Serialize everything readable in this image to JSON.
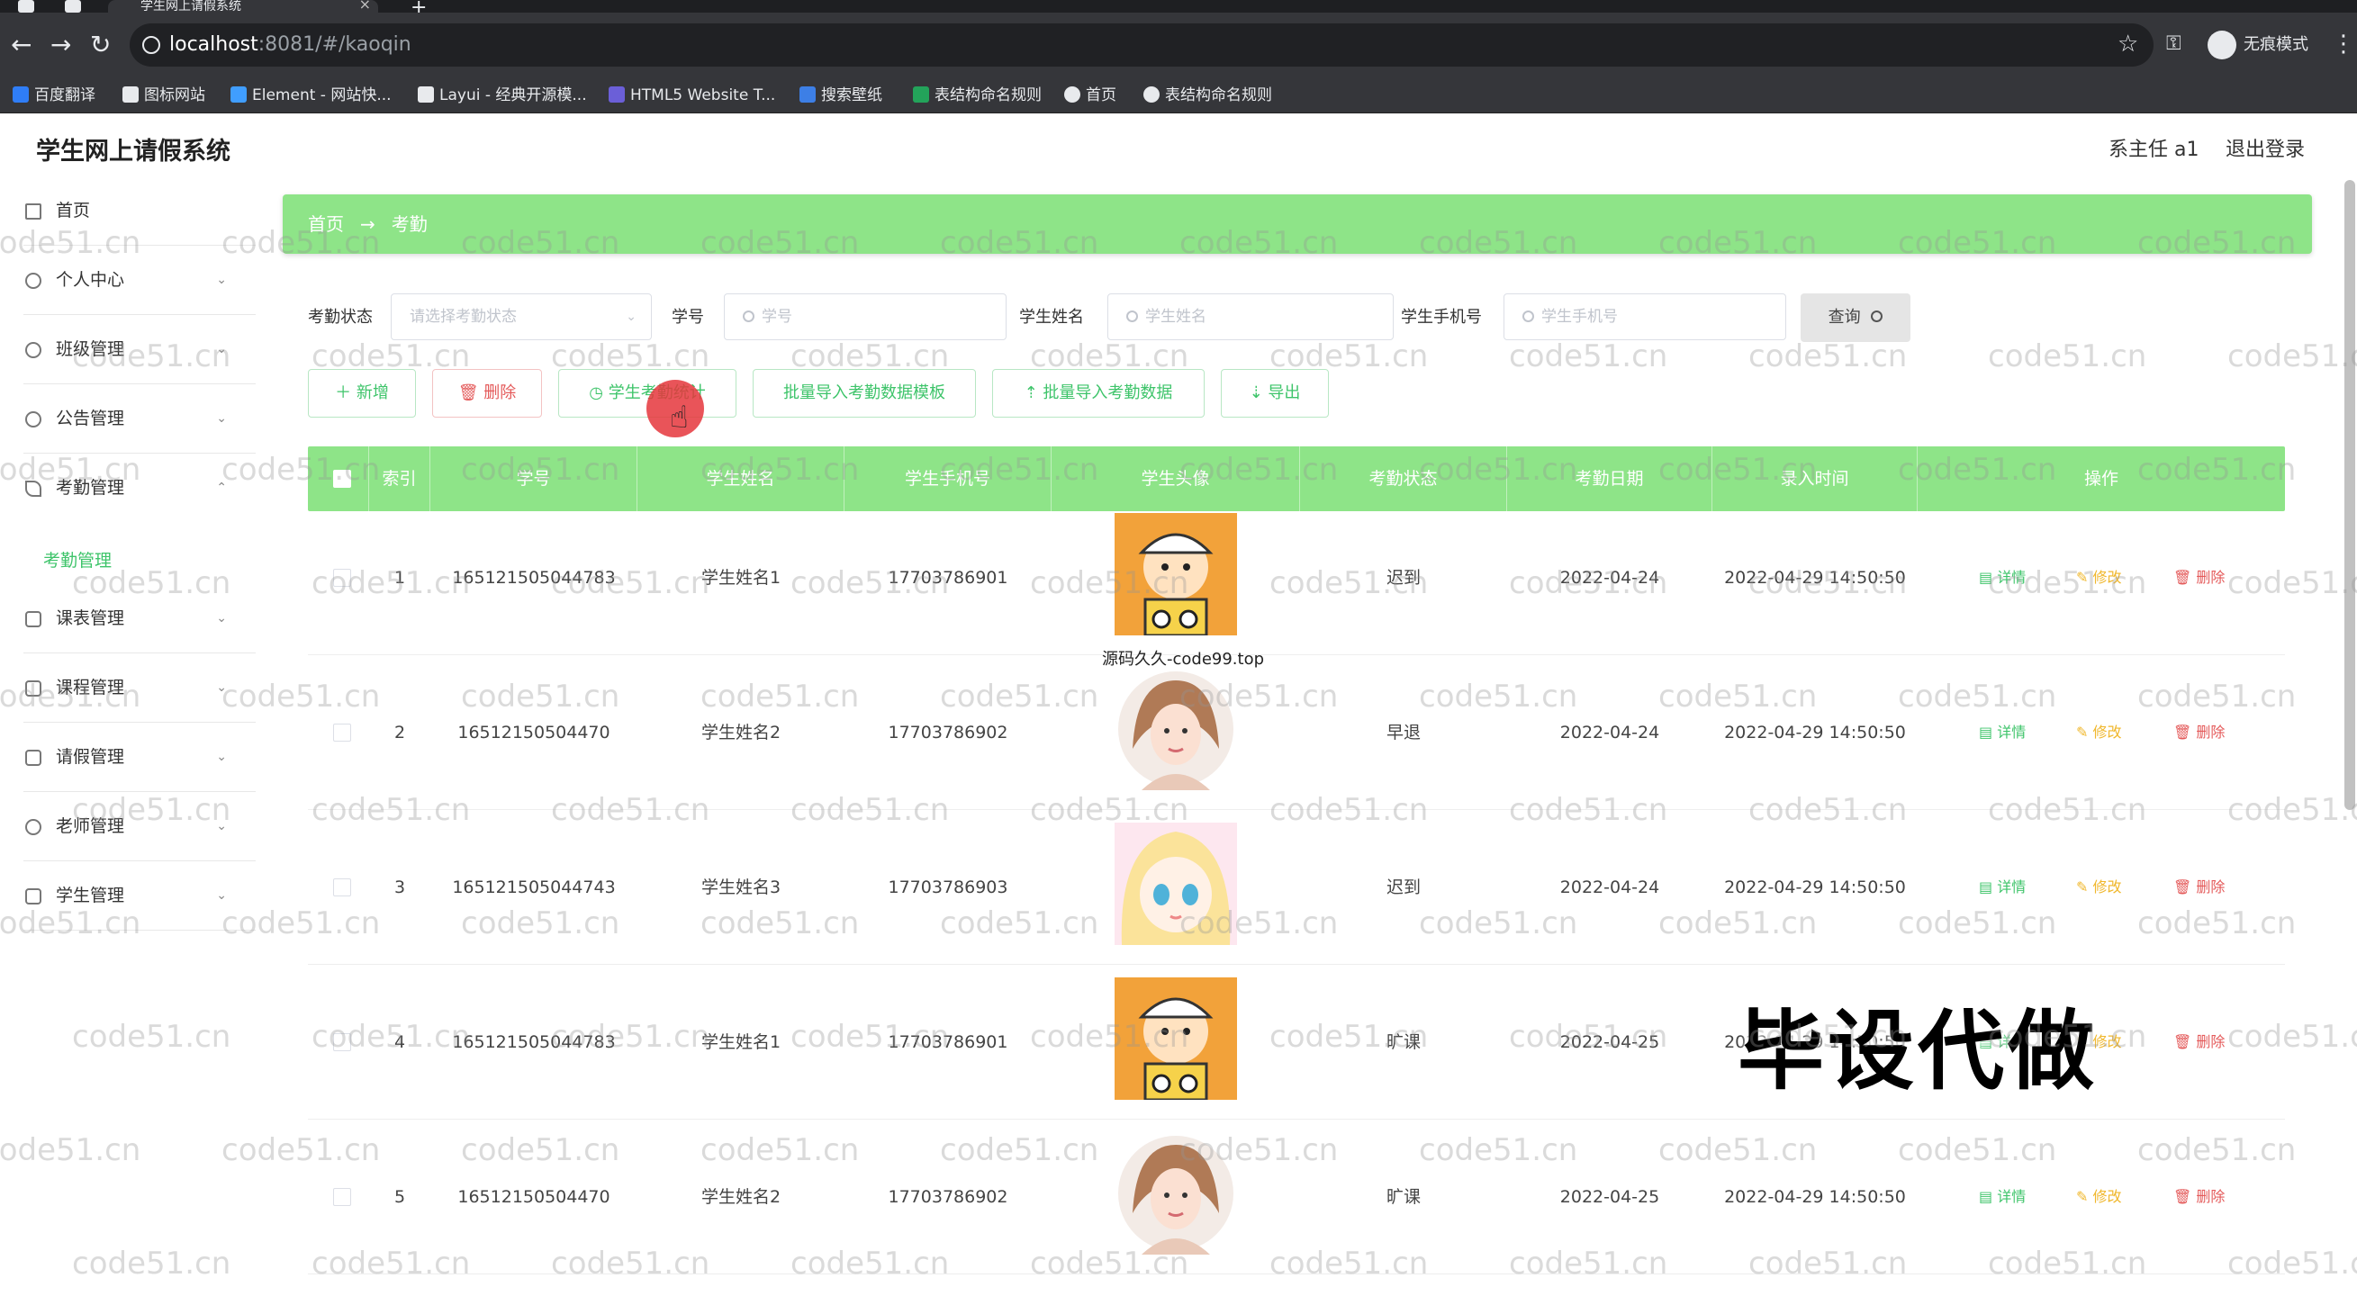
{
  "browser": {
    "tab_title": "学生网上请假系统",
    "tab_close": "×",
    "new_tab": "+",
    "url_host": "localhost",
    "url_path": ":8081/#/kaoqin",
    "incognito_label": "无痕模式",
    "bookmarks": [
      "百度翻译",
      "图标网站",
      "Element - 网站快...",
      "Layui - 经典开源模...",
      "HTML5 Website T...",
      "搜索壁纸",
      "表结构命名规则",
      "首页",
      "表结构命名规则"
    ]
  },
  "app": {
    "title": "学生网上请假系统",
    "user": "系主任 a1",
    "logout": "退出登录"
  },
  "sidebar": {
    "items": [
      {
        "label": "首页"
      },
      {
        "label": "个人中心"
      },
      {
        "label": "班级管理"
      },
      {
        "label": "公告管理"
      },
      {
        "label": "考勤管理"
      },
      {
        "label": "课表管理"
      },
      {
        "label": "课程管理"
      },
      {
        "label": "请假管理"
      },
      {
        "label": "老师管理"
      },
      {
        "label": "学生管理"
      }
    ],
    "active_sub": "考勤管理"
  },
  "breadcrumb": {
    "home": "首页",
    "sep": "→",
    "current": "考勤"
  },
  "filters": {
    "status_label": "考勤状态",
    "status_placeholder": "请选择考勤状态",
    "student_id_label": "学号",
    "student_id_placeholder": "学号",
    "student_name_label": "学生姓名",
    "student_name_placeholder": "学生姓名",
    "phone_label": "学生手机号",
    "phone_placeholder": "学生手机号",
    "query_button": "查询"
  },
  "actions": {
    "add": "＋ 新增",
    "delete": "删除",
    "stats": "学生考勤统计",
    "import_template": "批量导入考勤数据模板",
    "import": "批量导入考勤数据",
    "export": "导出"
  },
  "table": {
    "columns": [
      "索引",
      "学号",
      "学生姓名",
      "学生手机号",
      "学生头像",
      "考勤状态",
      "考勤日期",
      "录入时间",
      "操作"
    ],
    "rows": [
      {
        "index": "1",
        "student_id": "165121505044783",
        "name": "学生姓名1",
        "phone": "17703786901",
        "avatar": "cartoon-boy-avatar",
        "status": "迟到",
        "date": "2022-04-24",
        "created": "2022-04-29 14:50:50"
      },
      {
        "index": "2",
        "student_id": "16512150504470",
        "name": "学生姓名2",
        "phone": "17703786902",
        "avatar": "girl-portrait-avatar",
        "status": "早退",
        "date": "2022-04-24",
        "created": "2022-04-29 14:50:50"
      },
      {
        "index": "3",
        "student_id": "165121505044743",
        "name": "学生姓名3",
        "phone": "17703786903",
        "avatar": "anime-girl-avatar",
        "status": "迟到",
        "date": "2022-04-24",
        "created": "2022-04-29 14:50:50"
      },
      {
        "index": "4",
        "student_id": "165121505044783",
        "name": "学生姓名1",
        "phone": "17703786901",
        "avatar": "cartoon-boy-avatar",
        "status": "旷课",
        "date": "2022-04-25",
        "created": "2022-04-29 14:50:50"
      },
      {
        "index": "5",
        "student_id": "16512150504470",
        "name": "学生姓名2",
        "phone": "17703786902",
        "avatar": "girl-portrait-avatar",
        "status": "旷课",
        "date": "2022-04-25",
        "created": "2022-04-29 14:50:50"
      }
    ],
    "op_detail": "详情",
    "op_edit": "修改",
    "op_delete": "删除"
  },
  "overlay": {
    "caption": "源码久久-code99.top",
    "banner": "毕设代做",
    "watermark": "code51.cn"
  },
  "colors": {
    "accent_green": "#8ee488",
    "text_green": "#3ec46a",
    "danger": "#e45a5a",
    "warning": "#f0b72b"
  }
}
